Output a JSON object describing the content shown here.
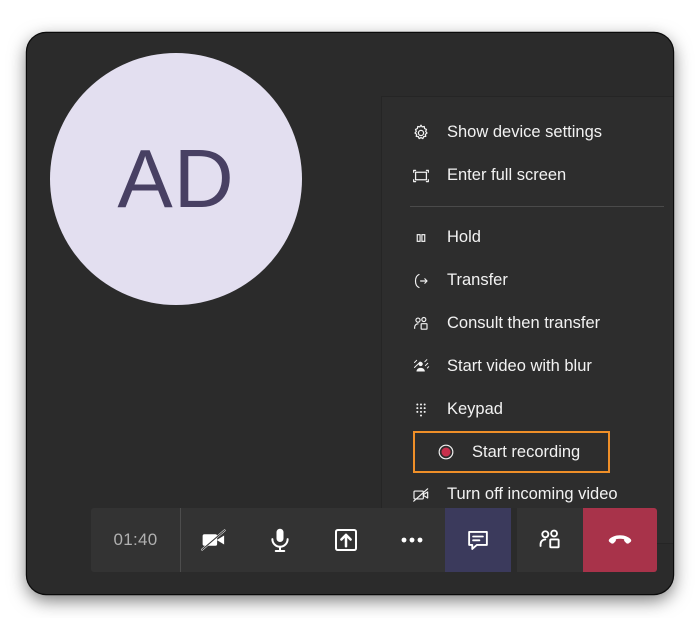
{
  "call": {
    "avatar_initials": "AD"
  },
  "menu": {
    "items": [
      {
        "label": "Show device settings",
        "icon": "gear-icon"
      },
      {
        "label": "Enter full screen",
        "icon": "fullscreen-icon"
      },
      {
        "label": "Hold",
        "icon": "pause-icon"
      },
      {
        "label": "Transfer",
        "icon": "call-transfer-icon"
      },
      {
        "label": "Consult then transfer",
        "icon": "people-icon"
      },
      {
        "label": "Start video with blur",
        "icon": "video-blur-icon"
      },
      {
        "label": "Keypad",
        "icon": "keypad-icon"
      },
      {
        "label": "Start recording",
        "icon": "record-icon",
        "highlighted": true
      },
      {
        "label": "Turn off incoming video",
        "icon": "video-off-icon"
      }
    ],
    "highlight_color": "#ef8f28"
  },
  "toolbar": {
    "duration": "01:40",
    "buttons": [
      {
        "name": "toggle-camera-button",
        "icon": "camera-off-icon"
      },
      {
        "name": "toggle-microphone-button",
        "icon": "microphone-icon"
      },
      {
        "name": "share-screen-button",
        "icon": "share-screen-icon"
      },
      {
        "name": "more-actions-button",
        "icon": "ellipsis-icon"
      },
      {
        "name": "toggle-chat-button",
        "icon": "chat-icon",
        "active": true
      },
      {
        "name": "show-participants-button",
        "icon": "people-icon"
      },
      {
        "name": "hang-up-button",
        "icon": "hang-up-icon"
      }
    ],
    "chat_active_color": "#3b3a5c",
    "hangup_color": "#a8334a"
  },
  "colors": {
    "window_background": "#2b2b2b",
    "menu_background": "#2d2d2d",
    "toolbar_background": "#333333",
    "avatar_background": "#e3dff0",
    "avatar_text": "#484063",
    "text_primary": "#f2f2f2",
    "timer_text": "#b0b0b0"
  }
}
